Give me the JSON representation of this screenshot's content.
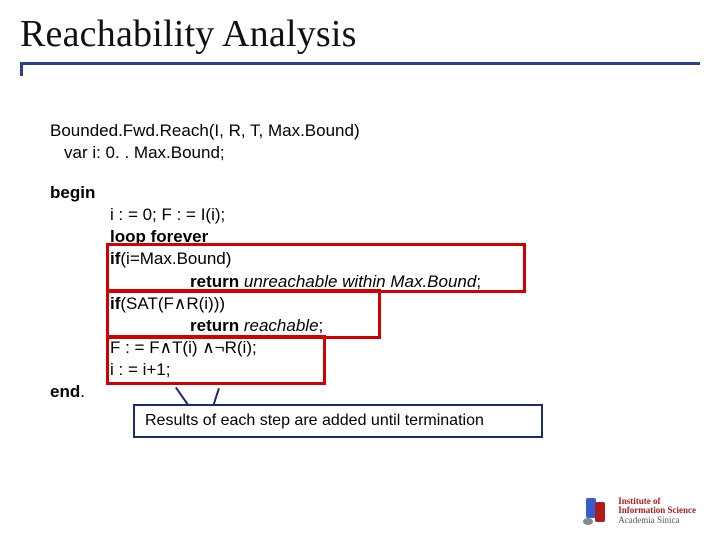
{
  "title": "Reachability Analysis",
  "decl_line1": "Bounded.Fwd.Reach(I, R, T, Max.Bound)",
  "decl_line2": "var i: 0. . Max.Bound;",
  "kw_begin": "begin",
  "kw_end": "end",
  "end_period": ".",
  "stmt_init": "i : = 0; F : = I(i);",
  "kw_loop_forever": "loop forever",
  "kw_if": "if",
  "cond_maxbound": "(i=Max.Bound)",
  "kw_return": "return",
  "ret_unreach_prefix": "unreachable within ",
  "ret_unreach_suffix": "Max.Bound",
  "semicolon": ";",
  "cond_sat": "(SAT(F∧R(i)))",
  "ret_reachable": "reachable",
  "stmt_update_F": "F : = F∧T(i) ∧¬R(i);",
  "stmt_inc": "i : = i+1;",
  "annotation": "Results of each step are added until termination",
  "logo": {
    "line1": "Institute of",
    "line2": "Information Science",
    "line3": "Academia Sinica"
  }
}
